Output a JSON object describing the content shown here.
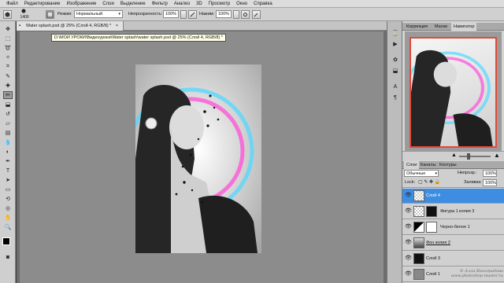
{
  "menubar": {
    "items": [
      "Файл",
      "Редактирование",
      "Изображение",
      "Слои",
      "Выделение",
      "Фильтр",
      "Анализ",
      "3D",
      "Просмотр",
      "Окно",
      "Справка"
    ]
  },
  "options": {
    "brush_size": "1400",
    "mode_label": "Режим:",
    "mode_value": "Нормальный",
    "opacity_label": "Непрозрачность:",
    "opacity_value": "100%",
    "pressure_label": "Нажим:",
    "pressure_value": "100%"
  },
  "document": {
    "tab_title": "Water splash.psd @ 25% (Слой 4, RGB/8) *",
    "tooltip_path": "D:\\МОИ УРОКИ\\Видеоуроки\\Water splash\\water splash.psd @ 25% (Слой 4, RGB/8) *"
  },
  "panels": {
    "top_tabs": [
      "Коррекция",
      "Маски",
      "Навигатор"
    ],
    "layer_tabs": [
      "Слои",
      "Каналы",
      "Контуры"
    ],
    "blend_mode": "Обычные",
    "opacity_label": "Непрозр.:",
    "opacity_value": "100%",
    "lock_label": "Lock:",
    "fill_label": "Заливка:",
    "fill_value": "100%",
    "layers": [
      {
        "name": "Слой 4"
      },
      {
        "name": "Фигура 1 копия 3"
      },
      {
        "name": "Черно-белое 1"
      },
      {
        "name": "Фон копия 2"
      },
      {
        "name": "Слой 3"
      },
      {
        "name": "Слой 1"
      }
    ],
    "watermark": "© Алла Виноградова www.photoshop-master.ru"
  },
  "colors": {
    "selected_layer": "#3d8ee3",
    "nav_frame": "#e04a3a",
    "accent_pink": "#ff4fd8",
    "accent_cyan": "#52d8ff"
  }
}
